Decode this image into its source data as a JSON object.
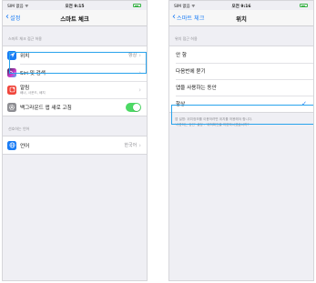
{
  "left": {
    "status": {
      "carrier": "SIM 없음 ᯤ",
      "time": "오전 9:15"
    },
    "nav": {
      "back": "설정",
      "title": "스마트 체크"
    },
    "section1_header": "스마트 체크 접근 허용",
    "rows": [
      {
        "icon": "location-arrow-icon",
        "color": "#1a7cf5",
        "label": "위치",
        "value": "항상"
      },
      {
        "icon": "siri-icon",
        "color": "#35354a",
        "label": "Siri 및 검색",
        "value": ""
      },
      {
        "icon": "notification-bell-icon",
        "color": "#f0463c",
        "label": "알림",
        "sub": "배너, 사운드, 배지"
      },
      {
        "icon": "gear-icon",
        "color": "#8e8e93",
        "label": "백그라운드 앱 새로 고침",
        "toggle_on": true
      }
    ],
    "section2_header": "선호하는 언어",
    "language": {
      "icon": "globe-icon",
      "color": "#1a7cf5",
      "label": "언어",
      "value": "한국어"
    }
  },
  "right": {
    "status": {
      "carrier": "SIM 없음 ᯤ",
      "time": "오전 9:16"
    },
    "nav": {
      "back": "스마트 체크",
      "title": "위치"
    },
    "section_header": "위치 접근 허용",
    "options": [
      {
        "label": "안 함",
        "selected": false
      },
      {
        "label": "다음번에 묻기",
        "selected": false
      },
      {
        "label": "앱을 사용하는 동안",
        "selected": false
      },
      {
        "label": "항상",
        "selected": true
      }
    ],
    "footnote1": "앱 설명: 위치정보를 이용하려면 위치를 허용해야 합니다.",
    "footnote2": "'사용하는 동안' 설정 : '위치확인을 허용하시겠습니까?'"
  },
  "colors": {
    "accent": "#1a7cf5",
    "highlight": "#29a3ec",
    "toggle_on": "#4cd964"
  }
}
